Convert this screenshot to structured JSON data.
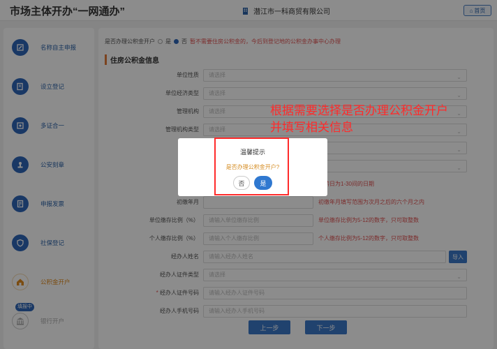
{
  "header": {
    "app_title": "市场主体开办“一网通办”",
    "company_name": "潜江市一科商贸有限公司",
    "home_label": "首页"
  },
  "sidebar": {
    "steps": [
      {
        "label": "名称自主申报",
        "icon": "name-declare-icon"
      },
      {
        "label": "设立登记",
        "icon": "register-icon"
      },
      {
        "label": "多证合一",
        "icon": "certificate-icon"
      },
      {
        "label": "公安刻章",
        "icon": "seal-icon"
      },
      {
        "label": "申报发票",
        "icon": "invoice-icon"
      },
      {
        "label": "社保登记",
        "icon": "shield-icon"
      },
      {
        "label": "公积金开户",
        "icon": "house-icon"
      },
      {
        "label": "银行开户",
        "icon": "bank-icon"
      }
    ],
    "filling_badge": "填报中"
  },
  "form": {
    "question_label": "是否办理公积金开户",
    "option_yes": "是",
    "option_no": "否",
    "question_note": "暂不需要住房公积金的，今后到登记地的公积金办事中心办理",
    "selected": "否",
    "section_title": "住房公积金信息",
    "fields": [
      {
        "label": "单位性质",
        "placeholder": "请选择",
        "type": "select"
      },
      {
        "label": "单位经济类型",
        "placeholder": "请选择",
        "type": "select"
      },
      {
        "label": "管理机构",
        "placeholder": "请选择",
        "type": "select"
      },
      {
        "label": "管理机构类型",
        "placeholder": "请选择",
        "type": "select"
      },
      {
        "label": "",
        "placeholder": "",
        "type": "select"
      },
      {
        "label": "",
        "placeholder": "",
        "type": "select"
      },
      {
        "label": "单位",
        "placeholder": "",
        "type": "input",
        "hint": "发薪日为1-30间的日期"
      },
      {
        "label": "初缴年月",
        "placeholder": "",
        "type": "input",
        "hint": "初缴年月填写范围为次月之后的六个月之内"
      },
      {
        "label": "单位缴存比例（%）",
        "placeholder": "请输入单位缴存比例",
        "type": "input",
        "hint": "单位缴存比例为5-12的数字，只可取整数"
      },
      {
        "label": "个人缴存比例（%）",
        "placeholder": "请输入个人缴存比例",
        "type": "input",
        "hint": "个人缴存比例为5-12的数字，只可取整数"
      },
      {
        "label": "经办人姓名",
        "placeholder": "请输入经办人姓名",
        "type": "input-import"
      },
      {
        "label": "经办人证件类型",
        "placeholder": "请选择",
        "type": "select"
      },
      {
        "label": "经办人证件号码",
        "placeholder": "请输入经办人证件号码",
        "type": "input",
        "required": true
      },
      {
        "label": "经办人手机号码",
        "placeholder": "请输入经办人手机号码",
        "type": "input"
      }
    ],
    "import_label": "导入",
    "prev_label": "上一步",
    "next_label": "下一步"
  },
  "annotation": {
    "line1": "根据需要选择是否办理公积金开户",
    "line2": "并填写相关信息"
  },
  "dialog": {
    "title": "温馨提示",
    "question": "是否办理公积金开户?",
    "no_label": "否",
    "yes_label": "是"
  },
  "colors": {
    "primary": "#2f66b8",
    "warning_text": "#e05353",
    "annotation_red": "#ff2a2a",
    "active_step": "#e08b1f"
  }
}
